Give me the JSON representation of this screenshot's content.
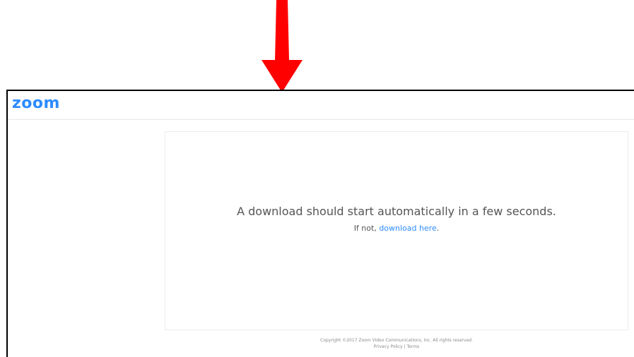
{
  "annotation": {
    "arrow_color": "#ff0000",
    "arrow_icon": "down-arrow-icon"
  },
  "header": {
    "logo_text": "zoom",
    "brand_color": "#2d8cff"
  },
  "main": {
    "headline": "A download should start automatically in a few seconds.",
    "subline_prefix": "If not, ",
    "download_link": "download here",
    "subline_suffix": "."
  },
  "footer": {
    "copyright": "Copyright ©2017 Zoom Video Communications, Inc. All rights reserved.",
    "privacy_link": "Privacy Policy",
    "separator": " | ",
    "terms_link": "Terms"
  }
}
